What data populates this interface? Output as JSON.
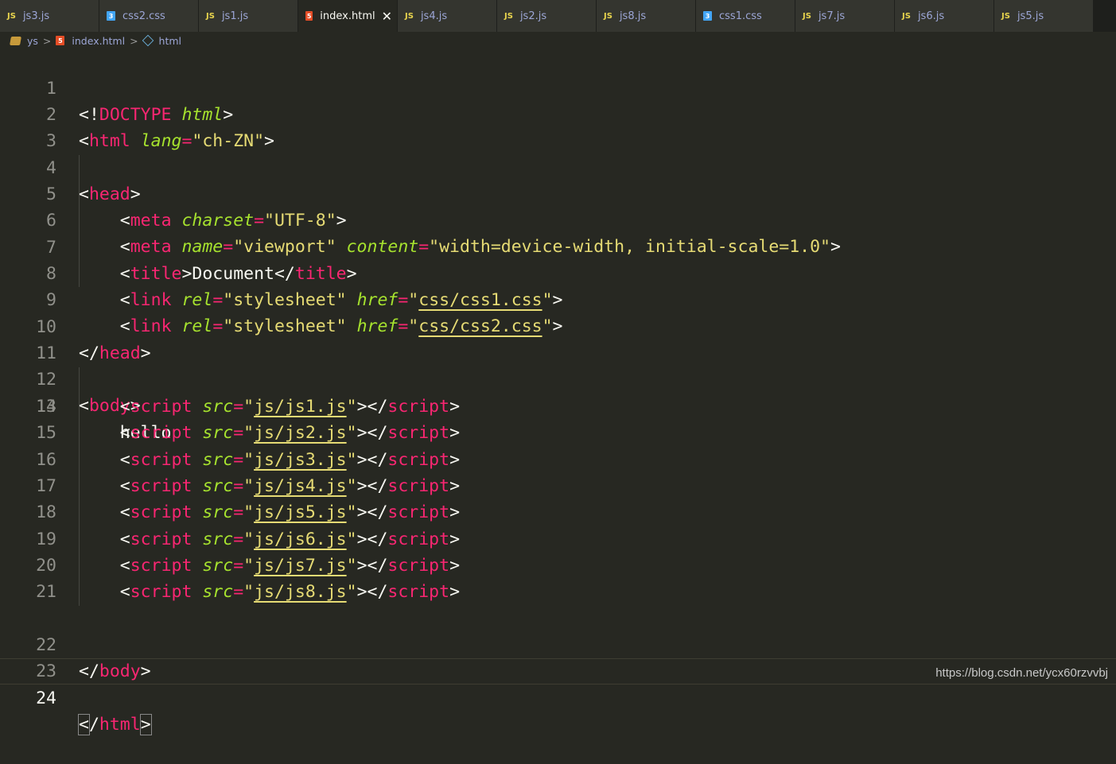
{
  "tabs": [
    {
      "label": "js3.js",
      "icon": "js-icon",
      "active": false
    },
    {
      "label": "css2.css",
      "icon": "css-icon",
      "active": false
    },
    {
      "label": "js1.js",
      "icon": "js-icon",
      "active": false
    },
    {
      "label": "index.html",
      "icon": "html-icon",
      "active": true
    },
    {
      "label": "js4.js",
      "icon": "js-icon",
      "active": false
    },
    {
      "label": "js2.js",
      "icon": "js-icon",
      "active": false
    },
    {
      "label": "js8.js",
      "icon": "js-icon",
      "active": false
    },
    {
      "label": "css1.css",
      "icon": "css-icon",
      "active": false
    },
    {
      "label": "js7.js",
      "icon": "js-icon",
      "active": false
    },
    {
      "label": "js6.js",
      "icon": "js-icon",
      "active": false
    },
    {
      "label": "js5.js",
      "icon": "js-icon",
      "active": false
    }
  ],
  "tab_close_glyph": "✕",
  "breadcrumb": [
    {
      "label": "ys",
      "icon": "folder-icon"
    },
    {
      "label": "index.html",
      "icon": "html-icon"
    },
    {
      "label": "html",
      "icon": "cube-icon"
    }
  ],
  "breadcrumb_separator": ">",
  "editor": {
    "current_line": 24,
    "lines": [
      {
        "n": "1"
      },
      {
        "n": "2"
      },
      {
        "n": "3"
      },
      {
        "n": "4"
      },
      {
        "n": "5"
      },
      {
        "n": "6"
      },
      {
        "n": "7"
      },
      {
        "n": "8"
      },
      {
        "n": "9"
      },
      {
        "n": "10"
      },
      {
        "n": "11"
      },
      {
        "n": "12"
      },
      {
        "n": "13"
      },
      {
        "n": "14"
      },
      {
        "n": "15"
      },
      {
        "n": "16"
      },
      {
        "n": "17"
      },
      {
        "n": "18"
      },
      {
        "n": "19"
      },
      {
        "n": "20"
      },
      {
        "n": "21"
      },
      {
        "n": "22"
      },
      {
        "n": "23"
      },
      {
        "n": "24"
      }
    ],
    "code": {
      "l1_lt": "<!",
      "l1_doctype": "DOCTYPE",
      "l1_html": "html",
      "l1_gt": ">",
      "l2_lt": "<",
      "l2_tag": "html",
      "l2_attr": "lang",
      "l2_eq": "=",
      "l2_val": "\"ch-ZN\"",
      "l2_gt": ">",
      "l4_lt": "<",
      "l4_tag": "head",
      "l4_gt": ">",
      "l5_lt": "<",
      "l5_tag": "meta",
      "l5_attr": "charset",
      "l5_eq": "=",
      "l5_val": "\"UTF-8\"",
      "l5_gt": ">",
      "l6_lt": "<",
      "l6_tag": "meta",
      "l6_attr1": "name",
      "l6_eq1": "=",
      "l6_val1": "\"viewport\"",
      "l6_attr2": "content",
      "l6_eq2": "=",
      "l6_val2": "\"width=device-width, initial-scale=1.0\"",
      "l6_gt": ">",
      "l7_lt": "<",
      "l7_tag": "title",
      "l7_gt": ">",
      "l7_text": "Document",
      "l7_lt2": "</",
      "l7_tag2": "title",
      "l7_gt2": ">",
      "l8_lt": "<",
      "l8_tag": "link",
      "l8_attr1": "rel",
      "l8_eq1": "=",
      "l8_val1": "\"stylesheet\"",
      "l8_attr2": "href",
      "l8_eq2": "=",
      "l8_q1": "\"",
      "l8_path": "css/css1.css",
      "l8_q2": "\"",
      "l8_gt": ">",
      "l9_lt": "<",
      "l9_tag": "link",
      "l9_attr1": "rel",
      "l9_eq1": "=",
      "l9_val1": "\"stylesheet\"",
      "l9_attr2": "href",
      "l9_eq2": "=",
      "l9_q1": "\"",
      "l9_path": "css/css2.css",
      "l9_q2": "\"",
      "l9_gt": ">",
      "l10_lt": "</",
      "l10_tag": "head",
      "l10_gt": ">",
      "l12_lt": "<",
      "l12_tag": "body",
      "l12_gt": ">",
      "l13_text": "hello",
      "scripts": [
        "js/js1.js",
        "js/js2.js",
        "js/js3.js",
        "js/js4.js",
        "js/js5.js",
        "js/js6.js",
        "js/js7.js",
        "js/js8.js"
      ],
      "script_open_lt": "<",
      "script_tag": "script",
      "script_attr": "src",
      "script_eq": "=",
      "script_q": "\"",
      "script_gt": ">",
      "script_close_lt": "</",
      "l22_lt": "</",
      "l22_tag": "body",
      "l22_gt": ">",
      "l24_lt": "<",
      "l24_slash": "/",
      "l24_tag": "html",
      "l24_gt": ">"
    }
  },
  "watermark": "https://blog.csdn.net/ycx60rzvvbj"
}
